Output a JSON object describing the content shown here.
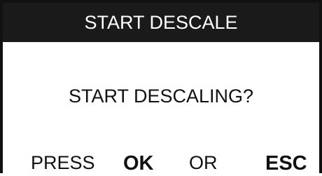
{
  "title": "START DESCALE",
  "message": "START DESCALING?",
  "footer": {
    "press": "PRESS",
    "ok": "OK",
    "or": "OR",
    "esc": "ESC"
  },
  "colors": {
    "titlebar_bg": "#1a1a1a",
    "titlebar_text": "#ffffff",
    "background": "#ffffff",
    "text": "#111111"
  }
}
